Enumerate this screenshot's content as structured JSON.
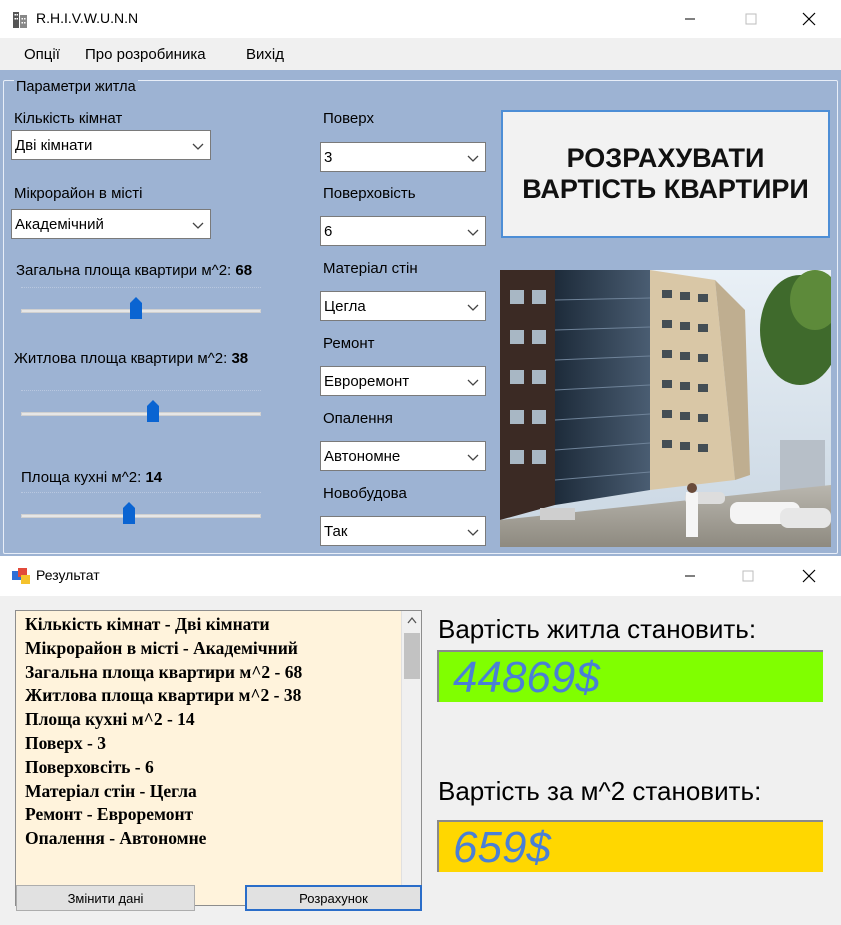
{
  "main_window": {
    "title": "R.H.I.V.W.U.N.N",
    "menu": [
      "Опції",
      "Про розробиника",
      "Вихід"
    ],
    "group_title": "Параметри житла",
    "rooms": {
      "label": "Кількість кімнат",
      "value": "Дві кімнати"
    },
    "district": {
      "label": "Мікрорайон в місті",
      "value": "Академічний"
    },
    "total_area": {
      "label": "Загальна площа квартири м^2:",
      "value": "68",
      "fill": 0.48
    },
    "living_area": {
      "label": "Житлова площа квартири м^2:",
      "value": "38",
      "fill": 0.55
    },
    "kitchen_area": {
      "label": "Площа кухні м^2:",
      "value": "14",
      "fill": 0.45
    },
    "floor": {
      "label": "Поверх",
      "value": "3"
    },
    "storeys": {
      "label": "Поверховість",
      "value": "6"
    },
    "wall_material": {
      "label": "Матеріал стін",
      "value": "Цегла"
    },
    "renovation": {
      "label": "Ремонт",
      "value": "Евроремонт"
    },
    "heating": {
      "label": "Опалення",
      "value": "Автономне"
    },
    "new_building": {
      "label": "Новобудова",
      "value": "Так"
    },
    "calc_button": {
      "line1": "РОЗРАХУВАТИ",
      "line2": "ВАРТІСТЬ КВАРТИРИ"
    }
  },
  "result_window": {
    "title": "Результат",
    "summary_lines": [
      "Кількість кімнат - Дві кімнати",
      "Мікрорайон в місті - Академічний",
      "Загальна площа квартири м^2 - 68",
      "Житлова площа квартири м^2 - 38",
      "Площа кухні м^2 - 14",
      "Поверх - 3",
      "Поверховсіть - 6",
      "Матеріал стін - Цегла",
      "Ремонт - Евроремонт",
      "Опалення - Автономне"
    ],
    "price_label": "Вартість житла становить:",
    "price_value": "44869$",
    "per_m2_label": "Вартість за м^2 становить:",
    "per_m2_value": "659$",
    "change_button": "Змінити дані",
    "calc_button": "Розрахунок"
  },
  "colors": {
    "form_bg": "#9db3d3",
    "price_bg": "#80ff00",
    "per_m2_bg": "#ffd700",
    "result_text": "#4a7fd6"
  },
  "icons": [
    "building-icon",
    "minimize-icon",
    "maximize-icon",
    "close-icon",
    "app-window-icon",
    "chevron-down-icon"
  ]
}
